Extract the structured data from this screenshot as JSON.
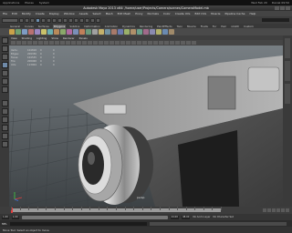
{
  "os_bar": {
    "left_items": [
      "Applications",
      "Places",
      "System"
    ],
    "right_items": [
      "Wed Feb 20",
      "Daniel 09:50"
    ]
  },
  "window": {
    "title": "Autodesk Maya 2013 x64: /home/user/Projects/Camera/scenes/CameraModel.mb"
  },
  "menubar": {
    "items": [
      "File",
      "Edit",
      "Modify",
      "Create",
      "Display",
      "Window",
      "Assets",
      "Select",
      "Mesh",
      "Edit Mesh",
      "Proxy",
      "Normals",
      "Color",
      "Create UVs",
      "Edit UVs",
      "Muscle",
      "Pipeline Cache",
      "Help"
    ]
  },
  "shelf": {
    "tabs": [
      "General",
      "Curves",
      "Surfaces",
      "Polygons",
      "Subdivs",
      "Deformation",
      "Animation",
      "Dynamics",
      "Rendering",
      "PaintEffects",
      "Toon",
      "Muscle",
      "Fluids",
      "Fur",
      "Hair",
      "nCloth",
      "Custom"
    ],
    "active_tab": "Polygons",
    "icon_colors": [
      "#c9a24a",
      "#6fa06f",
      "#7e9cc4",
      "#b87070",
      "#9a86c0",
      "#c9c26a",
      "#6ab0b0",
      "#b88a5a",
      "#8aa86a",
      "#b06aa0",
      "#7a8fb8",
      "#c0805a",
      "#6a9a7a",
      "#a0a0a0",
      "#c4b06a",
      "#7090a0",
      "#a87a6a",
      "#6a7ab0",
      "#9ab06a",
      "#b0906a",
      "#6aa08a",
      "#a06a8a",
      "#8a8ab0",
      "#b0b06a",
      "#6a8ab0",
      "#a08a6a"
    ]
  },
  "viewport": {
    "menu": [
      "View",
      "Shading",
      "Lighting",
      "Show",
      "Renderer",
      "Panels"
    ],
    "camera_label": "persp",
    "hud": {
      "headers": [
        "",
        "",
        ""
      ],
      "rows": [
        {
          "label": "Verts:",
          "v1": "104818",
          "v2": "0",
          "v3": "0"
        },
        {
          "label": "Edges:",
          "v1": "209336",
          "v2": "0",
          "v3": "0"
        },
        {
          "label": "Faces:",
          "v1": "104535",
          "v2": "0",
          "v3": "0"
        },
        {
          "label": "Tris:",
          "v1": "208968",
          "v2": "0",
          "v3": "0"
        },
        {
          "label": "UVs:",
          "v1": "113004",
          "v2": "0",
          "v3": "0"
        }
      ]
    }
  },
  "timeslider": {
    "current_frame": 1
  },
  "range": {
    "start": "1.00",
    "min": "1.00",
    "end": "24.00",
    "max": "48.00",
    "anim_layer": "No Anim Layer",
    "char_set": "No Character Set"
  },
  "cmdline": {
    "label": "MEL"
  },
  "helpline": {
    "text": "Move Tool: Select an object to move."
  }
}
